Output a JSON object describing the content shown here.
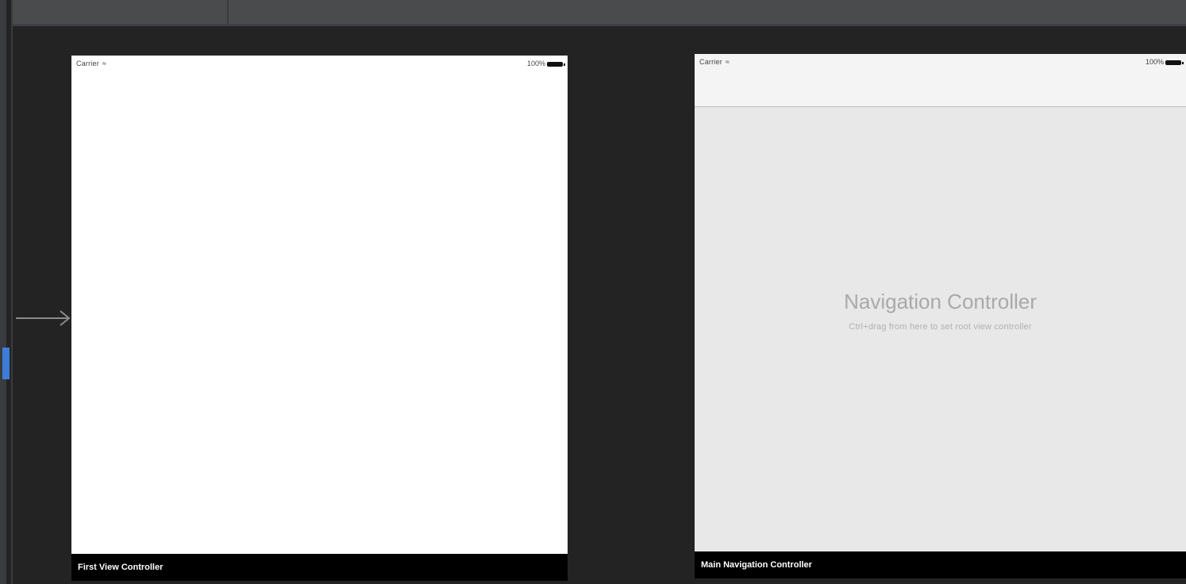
{
  "scenes": [
    {
      "status": {
        "carrier": "Carrier",
        "battery": "100%"
      },
      "label": "First View Controller"
    },
    {
      "status": {
        "carrier": "Carrier",
        "battery": "100%"
      },
      "title": "Navigation Controller",
      "subtitle": "Ctrl+drag from here to set root view controller",
      "label": "Main Navigation Controller"
    }
  ],
  "icons": {
    "wifi": "wifi-icon",
    "battery": "battery-icon",
    "entry_arrow": "arrow-right-icon"
  },
  "colors": {
    "canvas": "#232323",
    "selection_accent": "#3d7dd8",
    "scene_label_bg": "#000000",
    "nav_placeholder_bg": "#e8e8e8"
  }
}
